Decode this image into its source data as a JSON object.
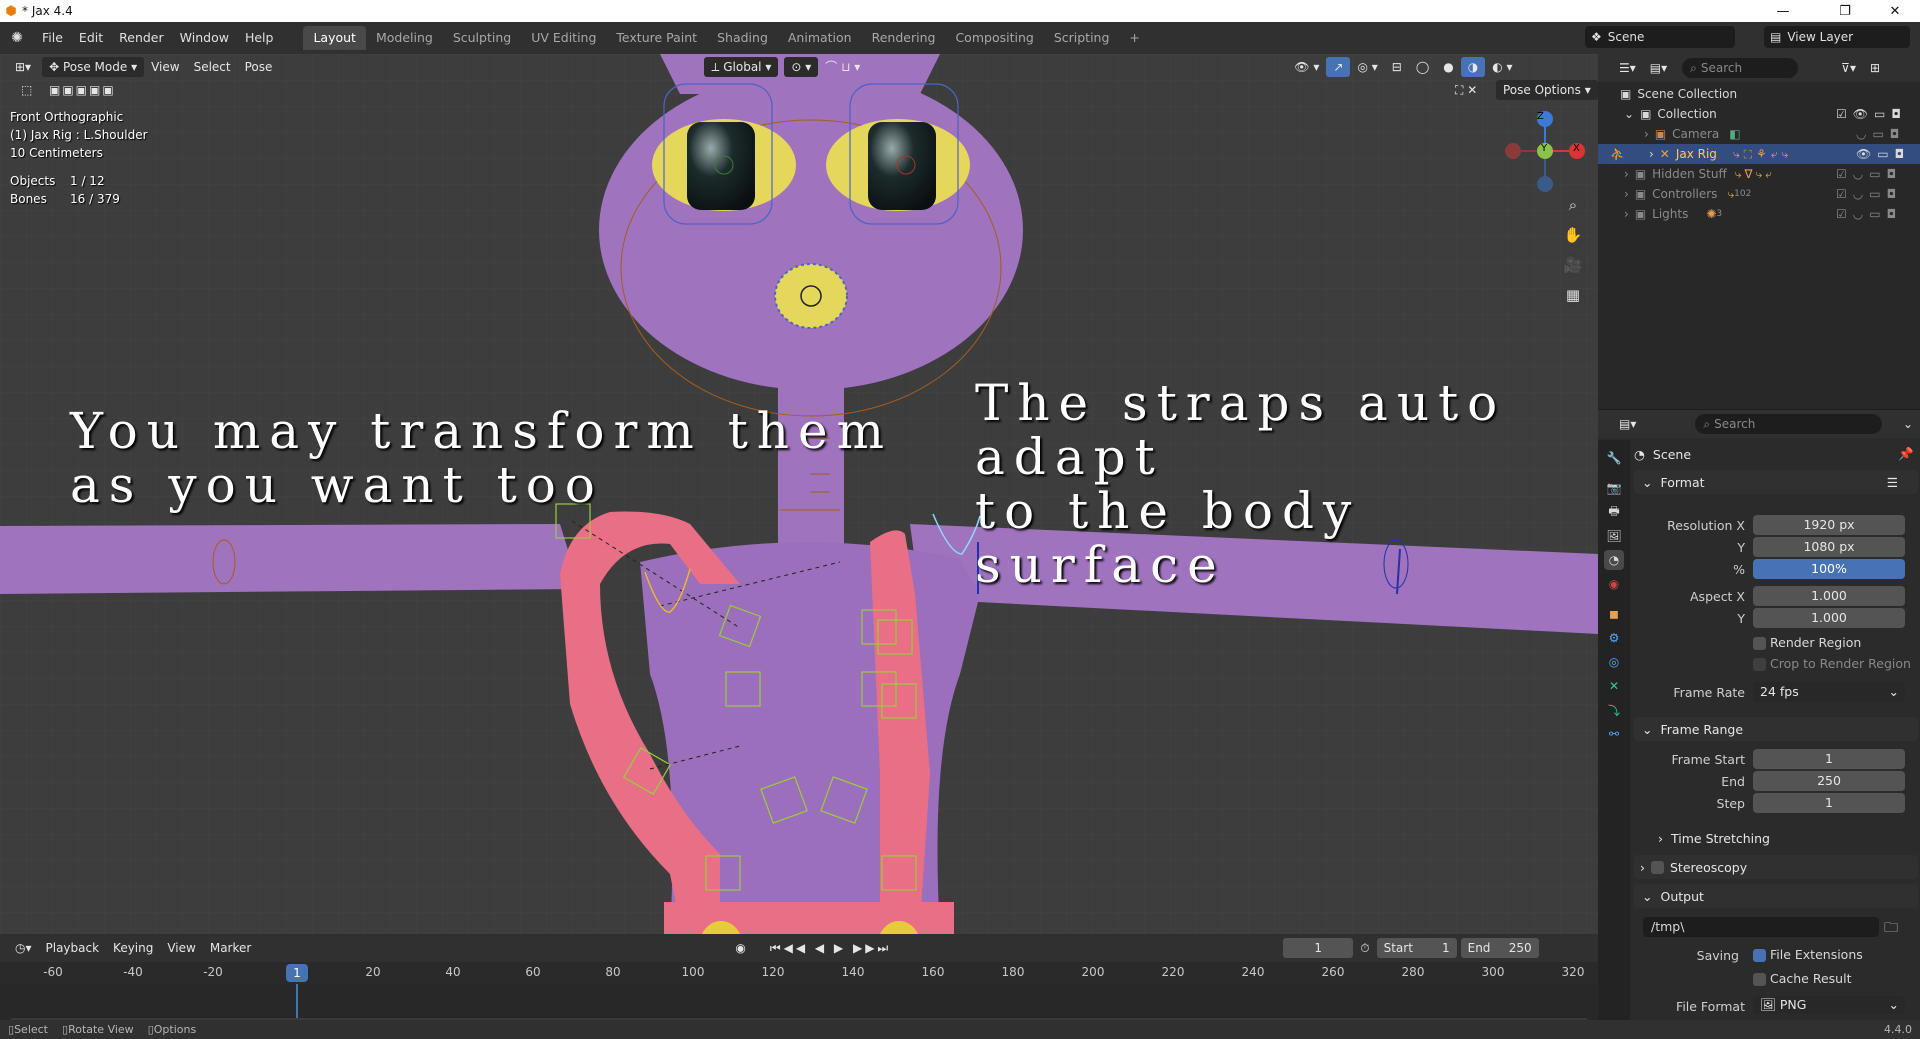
{
  "window": {
    "title": "* Jax 4.4"
  },
  "menu": [
    "File",
    "Edit",
    "Render",
    "Window",
    "Help"
  ],
  "workspaces": [
    {
      "label": "Layout",
      "active": true
    },
    {
      "label": "Modeling"
    },
    {
      "label": "Sculpting"
    },
    {
      "label": "UV Editing"
    },
    {
      "label": "Texture Paint"
    },
    {
      "label": "Shading"
    },
    {
      "label": "Animation"
    },
    {
      "label": "Rendering"
    },
    {
      "label": "Compositing"
    },
    {
      "label": "Scripting"
    }
  ],
  "scene_selector": {
    "scene": "Scene",
    "view_layer": "View Layer"
  },
  "viewport": {
    "mode": "Pose Mode",
    "menus": [
      "View",
      "Select",
      "Pose"
    ],
    "orientation": "Global",
    "pose_options": "Pose Options",
    "overlay": {
      "view_name": "Front Orthographic",
      "active": "(1) Jax Rig : L.Shoulder",
      "scale": "10 Centimeters",
      "objects_label": "Objects",
      "objects_value": "1 / 12",
      "bones_label": "Bones",
      "bones_value": "16 / 379"
    },
    "annotation_left": [
      "You may transform them",
      "as you want too"
    ],
    "annotation_right": [
      "The straps auto adapt",
      "to the body surface"
    ],
    "gizmo": {
      "z": "Z",
      "y": "Y",
      "x": "X"
    }
  },
  "timeline": {
    "menus": [
      "Playback",
      "Keying",
      "View",
      "Marker"
    ],
    "current_frame": "1",
    "start_label": "Start",
    "start_value": "1",
    "end_label": "End",
    "end_value": "250",
    "ticks": [
      "-60",
      "-40",
      "-20",
      "1",
      "20",
      "40",
      "60",
      "80",
      "100",
      "120",
      "140",
      "160",
      "180",
      "200",
      "220",
      "240",
      "260",
      "280",
      "300",
      "320"
    ]
  },
  "statusbar": {
    "select": "Select",
    "rotate": "Rotate View",
    "options": "Options",
    "version": "4.4.0"
  },
  "outliner": {
    "search_placeholder": "Search",
    "root": "Scene Collection",
    "items": [
      {
        "label": "Collection",
        "indent": 1
      },
      {
        "label": "Camera",
        "indent": 2
      },
      {
        "label": "Jax Rig",
        "indent": 2,
        "selected": true
      },
      {
        "label": "Hidden Stuff",
        "indent": 1
      },
      {
        "label": "Controllers",
        "indent": 1,
        "badge": "102"
      },
      {
        "label": "Lights",
        "indent": 1,
        "badge": "3"
      }
    ]
  },
  "properties": {
    "search_placeholder": "Search",
    "context": "Scene",
    "format": {
      "header": "Format",
      "res_x_label": "Resolution X",
      "res_x": "1920 px",
      "res_y_label": "Y",
      "res_y": "1080 px",
      "pct_label": "%",
      "pct": "100%",
      "aspect_x_label": "Aspect X",
      "aspect_x": "1.000",
      "aspect_y_label": "Y",
      "aspect_y": "1.000",
      "render_region": "Render Region",
      "crop": "Crop to Render Region",
      "fps_label": "Frame Rate",
      "fps": "24 fps"
    },
    "frame_range": {
      "header": "Frame Range",
      "start_label": "Frame Start",
      "start": "1",
      "end_label": "End",
      "end": "250",
      "step_label": "Step",
      "step": "1"
    },
    "time_stretching": "Time Stretching",
    "stereoscopy": "Stereoscopy",
    "output": {
      "header": "Output",
      "path": "/tmp\\",
      "saving_label": "Saving",
      "file_ext": "File Extensions",
      "cache": "Cache Result",
      "format_label": "File Format",
      "format": "PNG"
    }
  }
}
